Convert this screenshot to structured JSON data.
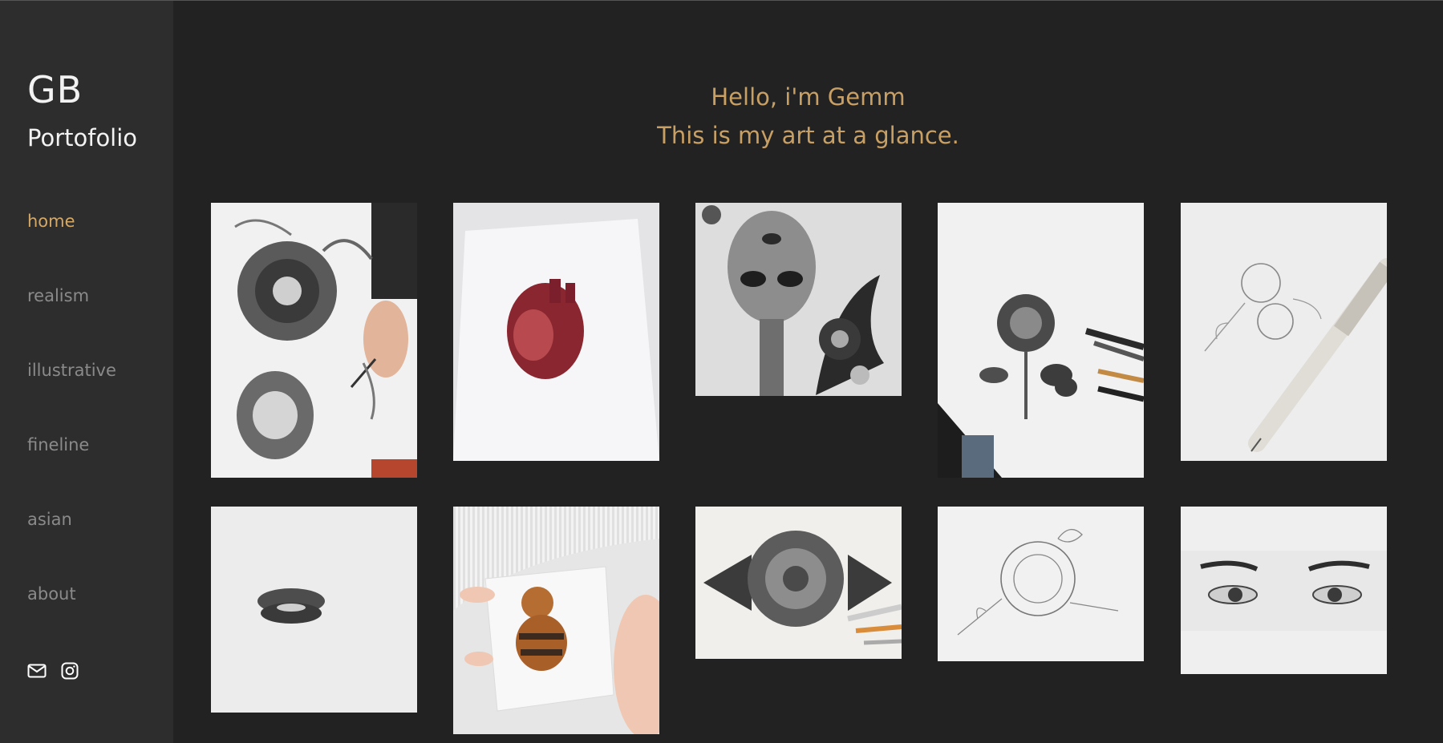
{
  "sidebar": {
    "logo": "GB",
    "subtitle": "Portofolio",
    "nav": [
      {
        "label": "home",
        "active": true
      },
      {
        "label": "realism",
        "active": false
      },
      {
        "label": "illustrative",
        "active": false
      },
      {
        "label": "fineline",
        "active": false
      },
      {
        "label": "asian",
        "active": false
      },
      {
        "label": "about",
        "active": false
      }
    ],
    "social_icons": [
      "mail-icon",
      "instagram-icon"
    ]
  },
  "main": {
    "greeting": "Hello, i'm Gemm",
    "tagline": "This is my art at a glance."
  },
  "gallery": [
    "foo-dog-skull-drawing",
    "anatomical-heart-drawing",
    "alien-third-eye-drawing",
    "rose-with-pencils-drawing",
    "fineline-flowers-drawing",
    "lips-drawing",
    "teddy-bear-drawing",
    "geometric-rose-drawing",
    "peony-outline-drawing",
    "eyes-drawing"
  ],
  "colors": {
    "background": "#222222",
    "sidebar": "#2d2d2d",
    "accent": "#d4a867",
    "nav_text": "#8a8a8a",
    "logo_text": "#f2f2f2"
  }
}
